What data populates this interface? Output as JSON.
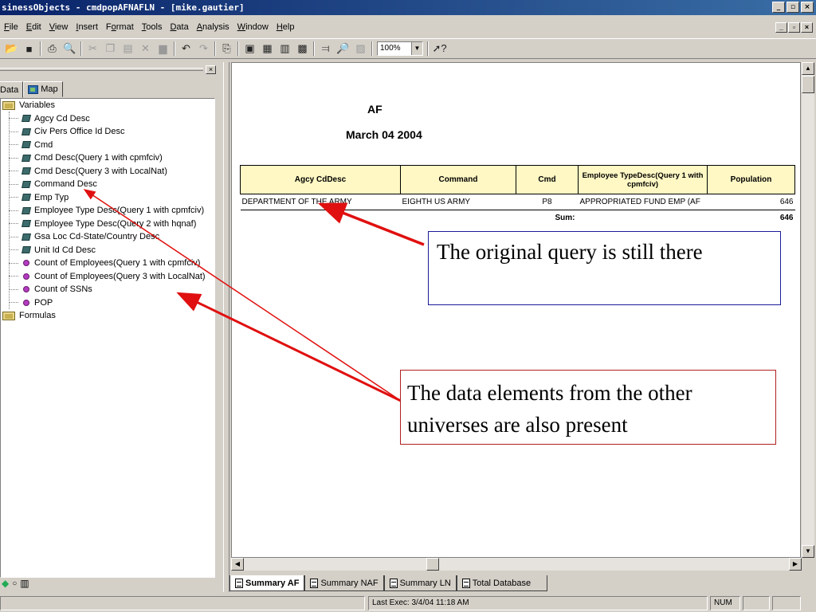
{
  "window": {
    "title": "sinessObjects - cmdpopAFNAFLN - [mike.gautier]",
    "controls": [
      "_",
      "▫",
      "×"
    ]
  },
  "menu": {
    "items": [
      {
        "label": "File",
        "key": "F"
      },
      {
        "label": "Edit",
        "key": "E"
      },
      {
        "label": "View",
        "key": "V"
      },
      {
        "label": "Insert",
        "key": "I"
      },
      {
        "label": "Format",
        "key": "o"
      },
      {
        "label": "Tools",
        "key": "T"
      },
      {
        "label": "Data",
        "key": "D"
      },
      {
        "label": "Analysis",
        "key": "A"
      },
      {
        "label": "Window",
        "key": "W"
      },
      {
        "label": "Help",
        "key": "H"
      }
    ]
  },
  "toolbar": {
    "zoom": "100%"
  },
  "left_panel": {
    "tabs": [
      {
        "label": "Data"
      },
      {
        "label": "Map"
      }
    ],
    "tree": {
      "variables_label": "Variables",
      "items": [
        {
          "label": "Agcy Cd Desc",
          "kind": "dimension"
        },
        {
          "label": "Civ Pers Office Id Desc",
          "kind": "dimension"
        },
        {
          "label": "Cmd",
          "kind": "dimension"
        },
        {
          "label": "Cmd Desc(Query 1 with cpmfciv)",
          "kind": "dimension"
        },
        {
          "label": "Cmd Desc(Query 3 with LocalNat)",
          "kind": "dimension"
        },
        {
          "label": "Command Desc",
          "kind": "dimension"
        },
        {
          "label": "Emp Typ",
          "kind": "dimension"
        },
        {
          "label": "Employee Type Desc(Query 1 with cpmfciv)",
          "kind": "dimension"
        },
        {
          "label": "Employee Type Desc(Query 2 with hqnaf)",
          "kind": "dimension"
        },
        {
          "label": "Gsa Loc Cd-State/Country Desc",
          "kind": "dimension"
        },
        {
          "label": "Unit Id Cd Desc",
          "kind": "dimension"
        },
        {
          "label": "Count of Employees(Query 1 with cpmfciv)",
          "kind": "measure"
        },
        {
          "label": "Count of Employees(Query 3 with LocalNat)",
          "kind": "measure"
        },
        {
          "label": "Count of SSNs",
          "kind": "measure"
        },
        {
          "label": "POP",
          "kind": "measure"
        }
      ],
      "formulas_label": "Formulas"
    }
  },
  "report": {
    "title": "AF",
    "date": "March 04  2004",
    "columns": [
      "Agcy CdDesc",
      "Command",
      "Cmd",
      "Employee TypeDesc(Query 1 with cpmfciv)",
      "Population"
    ],
    "rows": [
      [
        "DEPARTMENT OF THE ARMY",
        "EIGHTH US ARMY",
        "P8",
        "APPROPRIATED FUND EMP  (AF",
        "646"
      ]
    ],
    "sum_label": "Sum:",
    "sum_value": "646"
  },
  "sheet_tabs": [
    {
      "label": "Summary AF",
      "active": true
    },
    {
      "label": "Summary NAF",
      "active": false
    },
    {
      "label": "Summary LN",
      "active": false
    },
    {
      "label": "Total Database",
      "active": false
    }
  ],
  "status": {
    "last_exec": "Last Exec: 3/4/04  11:18 AM",
    "num": "NUM"
  },
  "annotations": {
    "callout1": "The original query is still there",
    "callout2": "The data elements from the other universes are also present"
  },
  "colors": {
    "titlebar": "#0a246a",
    "header_fill": "#fff8c4",
    "arrow": "#e01010",
    "callout1_border": "#1a1a9a",
    "callout2_border": "#b02020"
  }
}
